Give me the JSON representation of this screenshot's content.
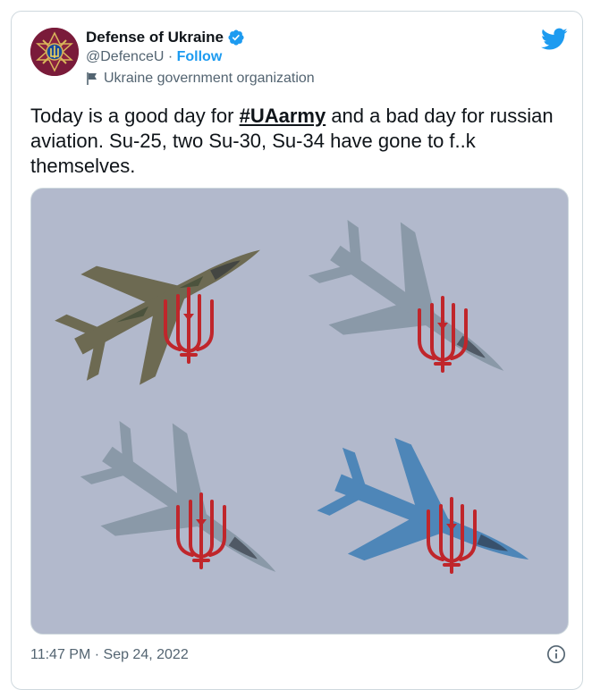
{
  "tweet": {
    "author": {
      "name": "Defense of Ukraine",
      "handle": "@DefenceU",
      "follow_label": "Follow",
      "separator": " · ",
      "label": "Ukraine government organization",
      "verified": true
    },
    "text_before": "Today is a good day for ",
    "hashtag": "#UAarmy",
    "text_after": " and a bad day for russian aviation. Su-25, two Su-30, Su-34 have gone to f..k themselves.",
    "timestamp": "11:47 PM · Sep 24, 2022",
    "media": {
      "background_color": "#b2b9cc",
      "overlay_color": "#c0262b",
      "aircraft": [
        "Su-25",
        "Su-30",
        "Su-30",
        "Su-34"
      ]
    }
  },
  "colors": {
    "brand": "#1d9bf0",
    "text": "#0f1419",
    "muted": "#536471"
  },
  "icons": [
    "verified-badge-icon",
    "twitter-bird-icon",
    "flag-icon",
    "info-icon"
  ]
}
